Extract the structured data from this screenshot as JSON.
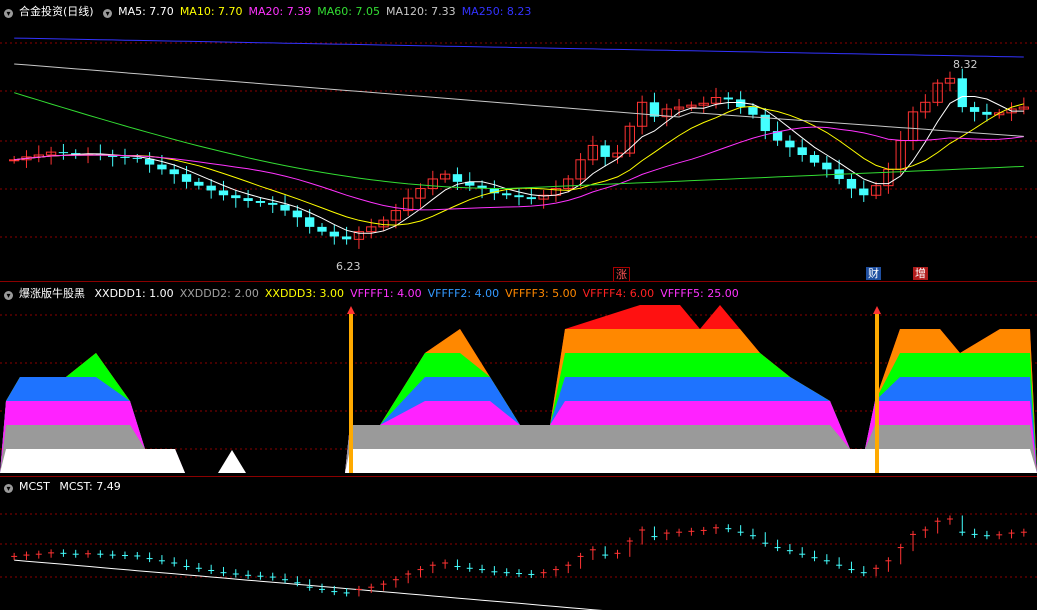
{
  "panel1": {
    "title": "合金投资(日线)",
    "ma": [
      {
        "label": "MA5: 7.70",
        "color": "#ffffff"
      },
      {
        "label": "MA10: 7.70",
        "color": "#ffff00"
      },
      {
        "label": "MA20: 7.39",
        "color": "#ff33ff"
      },
      {
        "label": "MA60: 7.05",
        "color": "#33dd33"
      },
      {
        "label": "MA120: 7.33",
        "color": "#c8c8c8"
      },
      {
        "label": "MA250: 8.23",
        "color": "#3333ff"
      }
    ],
    "high_label": "8.32",
    "low_label": "6.23",
    "markers": {
      "zhang": "涨",
      "cai": "财",
      "zeng": "增"
    }
  },
  "panel2": {
    "title": "爆涨版牛股黑",
    "items": [
      {
        "label": "XXDDD1: 1.00",
        "color": "#ffffff"
      },
      {
        "label": "XXDDD2: 2.00",
        "color": "#a0a0a0"
      },
      {
        "label": "XXDDD3: 3.00",
        "color": "#ffff00"
      },
      {
        "label": "VFFFF1: 4.00",
        "color": "#ff33ff"
      },
      {
        "label": "VFFFF2: 4.00",
        "color": "#3399ff"
      },
      {
        "label": "VFFFF3: 5.00",
        "color": "#ff8800"
      },
      {
        "label": "VFFFF4: 6.00",
        "color": "#ff2222"
      },
      {
        "label": "VFFFF5: 25.00",
        "color": "#ff33ff"
      }
    ]
  },
  "panel3": {
    "title": "MCST",
    "value_label": "MCST: 7.49"
  },
  "colors": {
    "up": "#ff3333",
    "down": "#44ffff",
    "grid": "#8b0000",
    "white": "#ffffff",
    "gray": "#9a9a9a",
    "magenta": "#ff22ff",
    "blue": "#1e73ff",
    "green": "#00ff00",
    "orange": "#ff8800",
    "red": "#ff1111",
    "signal": "#ffaa00"
  }
}
